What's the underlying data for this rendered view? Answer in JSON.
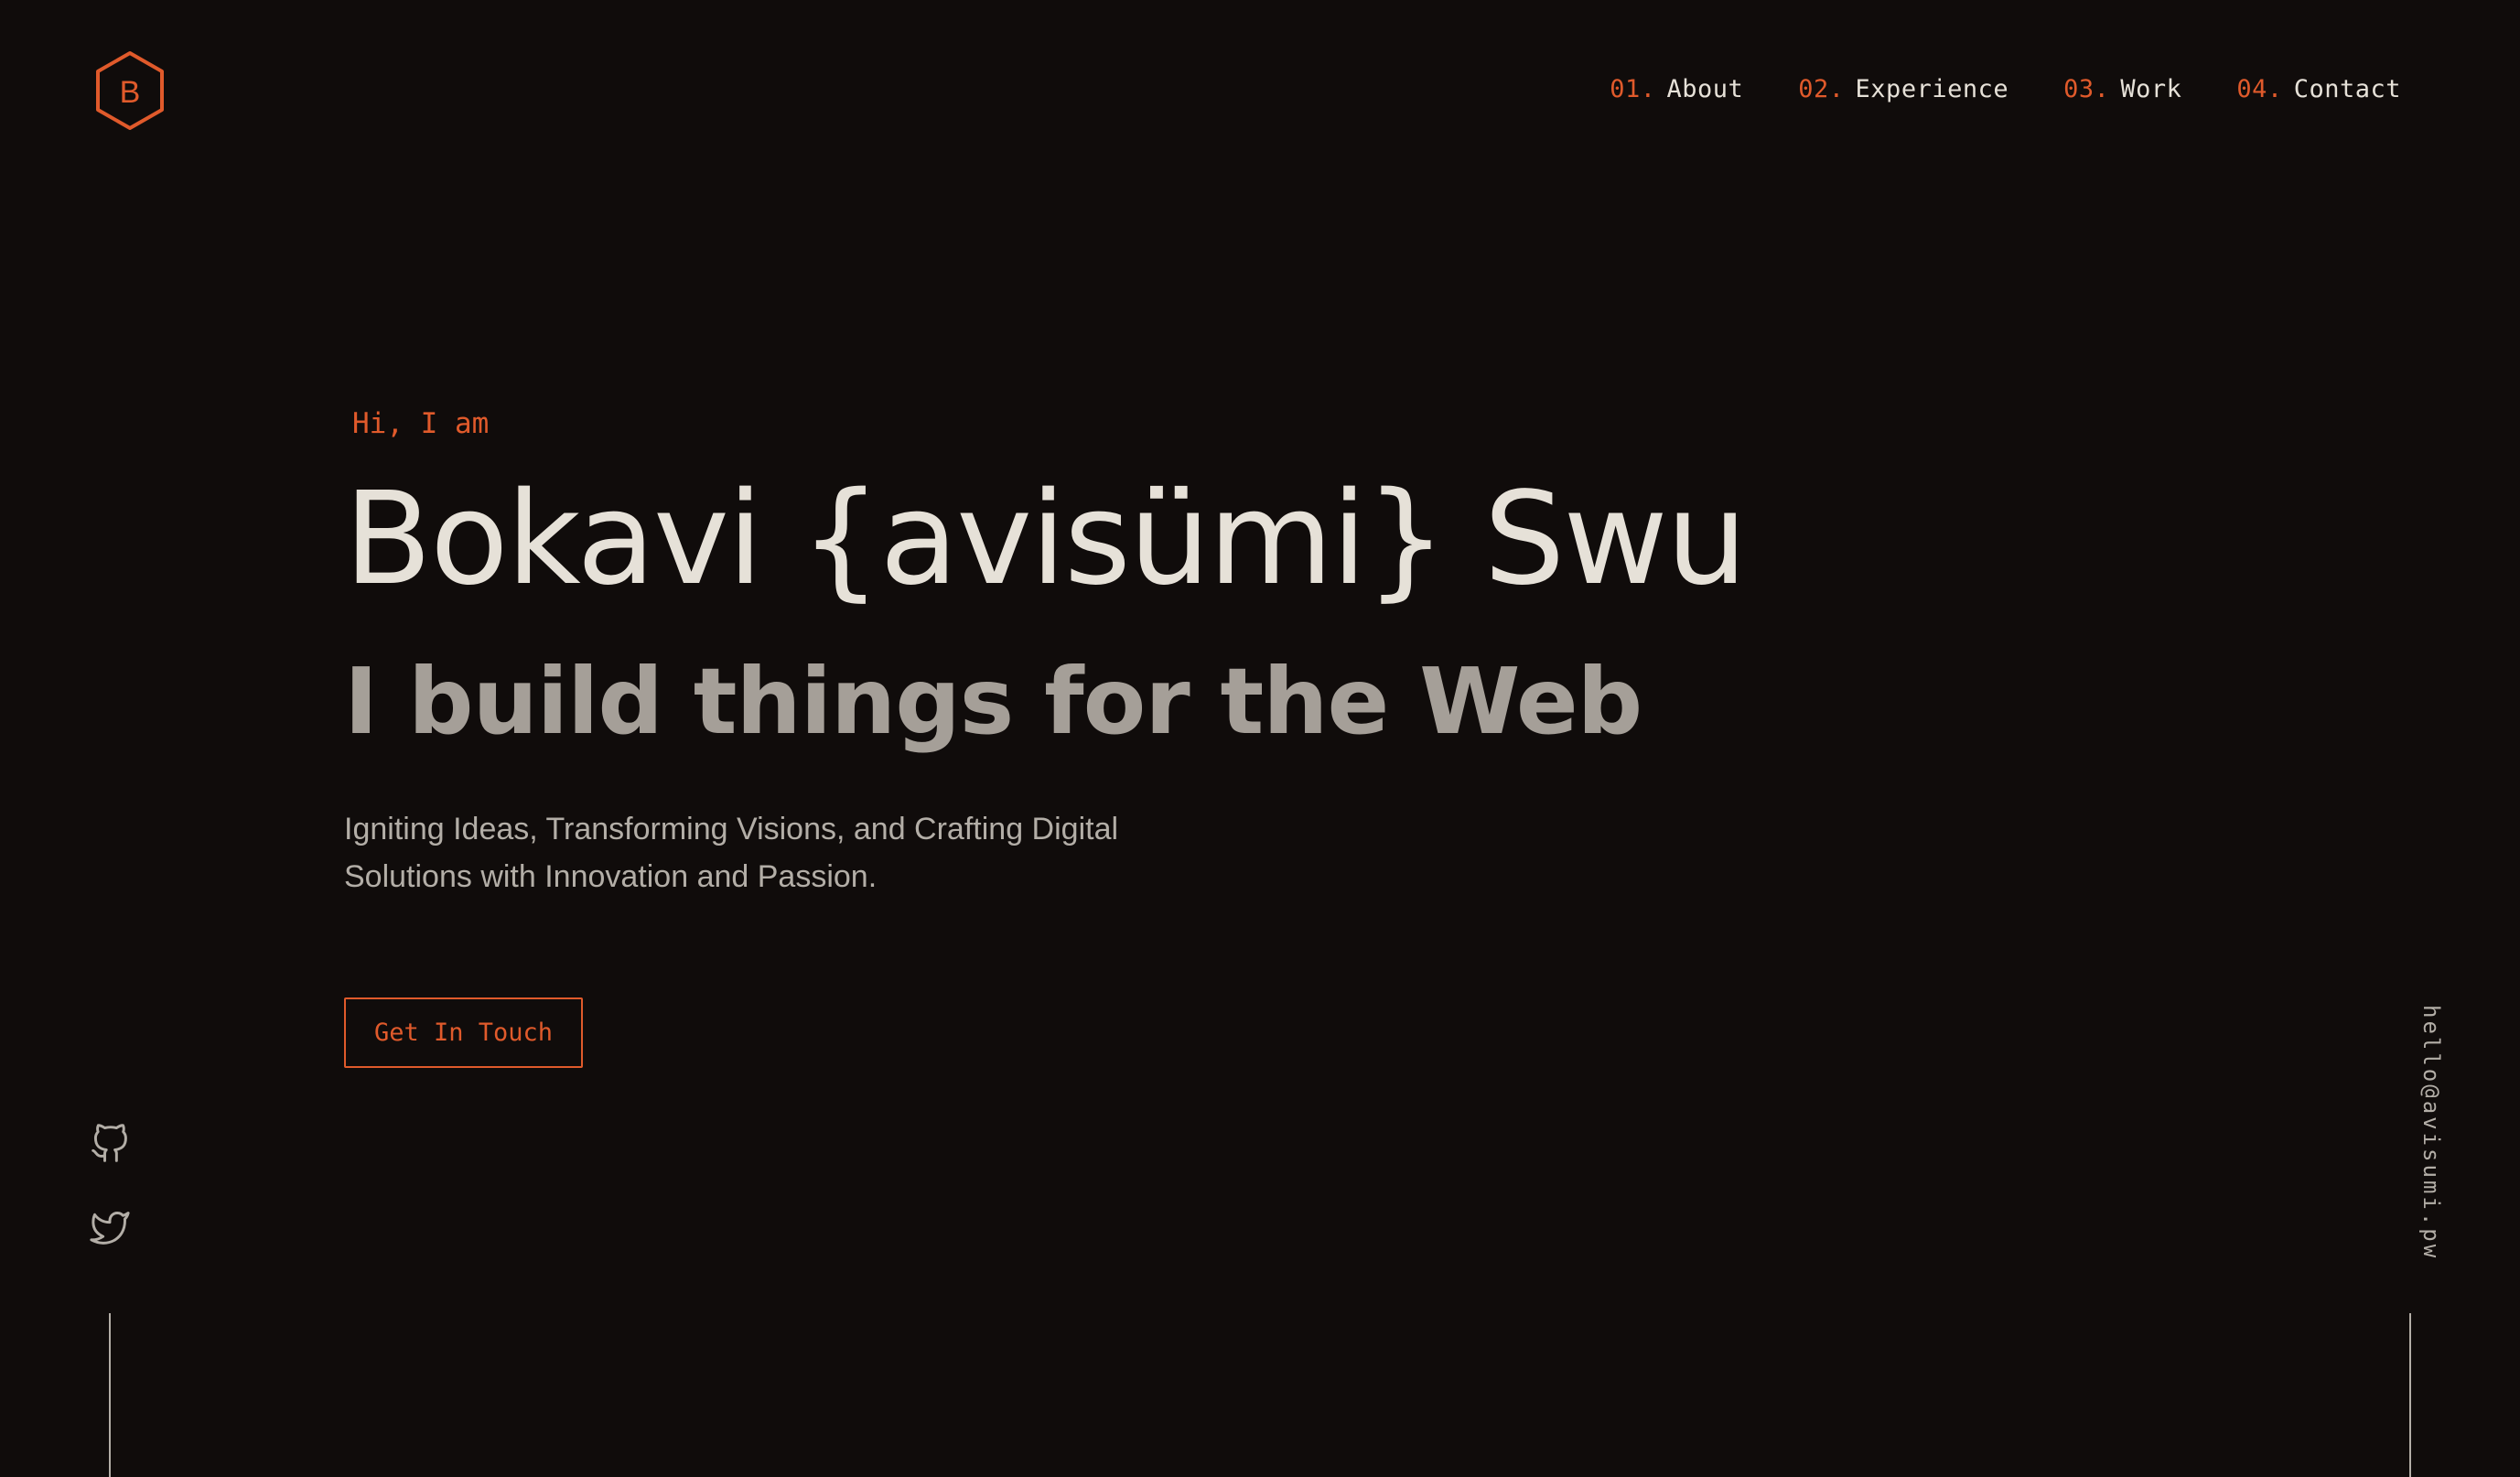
{
  "colors": {
    "background": "#100c0b",
    "accent": "#e05a2b",
    "text_primary": "#e6e1d8",
    "text_secondary": "#a59f98",
    "text_muted": "#b3aea7"
  },
  "logo": {
    "letter": "B",
    "icon": "hexagon-logo-icon"
  },
  "nav": {
    "items": [
      {
        "number": "01.",
        "label": "About"
      },
      {
        "number": "02.",
        "label": "Experience"
      },
      {
        "number": "03.",
        "label": "Work"
      },
      {
        "number": "04.",
        "label": "Contact"
      }
    ]
  },
  "hero": {
    "greeting": "Hi, I am",
    "name": "Bokavi {avisümi} Swu",
    "tagline": "I build things for the Web",
    "description": "Igniting Ideas, Transforming Visions, and Crafting Digital Solutions with Innovation and Passion.",
    "cta_label": "Get In Touch"
  },
  "social": {
    "links": [
      {
        "icon": "github-icon"
      },
      {
        "icon": "twitter-icon"
      }
    ]
  },
  "email": "hello@avisumi.pw"
}
